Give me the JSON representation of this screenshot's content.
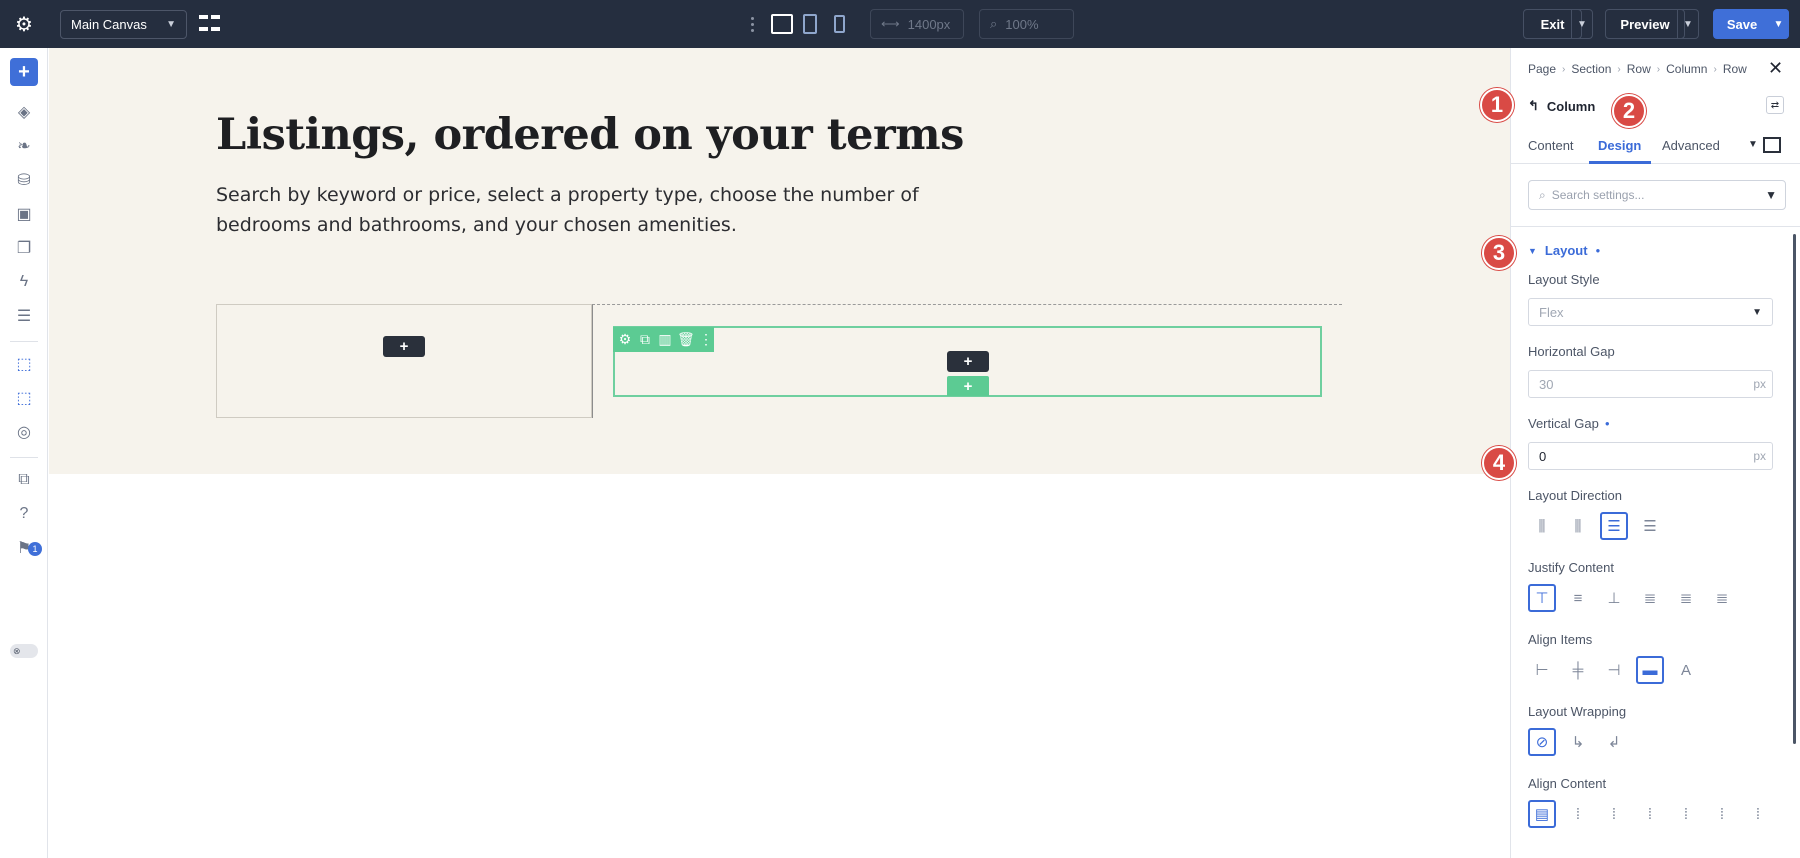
{
  "topbar": {
    "canvas_name": "Main Canvas",
    "width_value": "1400px",
    "zoom_value": "100%",
    "exit_label": "Exit",
    "preview_label": "Preview",
    "save_label": "Save"
  },
  "leftbar": {
    "notification_count": "1"
  },
  "hero": {
    "title": "Listings, ordered on your terms",
    "subtitle": "Search by keyword or price, select a property type, choose the number of bedrooms and bathrooms, and your chosen amenities."
  },
  "panel": {
    "breadcrumbs": [
      "Page",
      "Section",
      "Row",
      "Column",
      "Row"
    ],
    "element_title": "Column",
    "tabs": [
      "Content",
      "Design",
      "Advanced"
    ],
    "search_placeholder": "Search settings...",
    "layout_section": "Layout",
    "layout_style_label": "Layout Style",
    "layout_style_value": "Flex",
    "horizontal_gap_label": "Horizontal Gap",
    "horizontal_gap_placeholder": "30",
    "horizontal_gap_unit": "px",
    "vertical_gap_label": "Vertical Gap",
    "vertical_gap_value": "0",
    "vertical_gap_unit": "px",
    "layout_direction_label": "Layout Direction",
    "justify_content_label": "Justify Content",
    "align_items_label": "Align Items",
    "layout_wrapping_label": "Layout Wrapping",
    "align_content_label": "Align Content"
  },
  "markers": [
    "1",
    "2",
    "3",
    "4"
  ],
  "colors": {
    "accent": "#3f6fd8",
    "topbar": "#252e3f",
    "hero_bg": "#f6f3ec",
    "row_outline": "#5ccb93",
    "marker": "#d94a45"
  }
}
